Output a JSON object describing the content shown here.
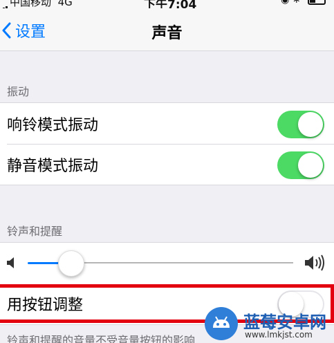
{
  "status_bar": {
    "carrier": "中国移动",
    "network": "4G",
    "time": "下午7:04"
  },
  "nav": {
    "back_label": "设置",
    "title": "声音"
  },
  "vibration_section": {
    "header": "振动",
    "rows": [
      {
        "label": "响铃模式振动",
        "toggle": "on"
      },
      {
        "label": "静音模式振动",
        "toggle": "on"
      }
    ]
  },
  "ringer_section": {
    "header": "铃声和提醒",
    "volume_level": 0.2
  },
  "button_adjust": {
    "label": "用按钮调整",
    "toggle": "off"
  },
  "footer": {
    "text": "铃声和提醒的音量不受音量按钮的影响"
  },
  "watermark": {
    "title": "蓝莓安卓网",
    "url": "www.lmkjst.com"
  },
  "colors": {
    "accent": "#007aff",
    "toggle_on": "#4cd964",
    "highlight": "#e3000f",
    "background": "#efeff4"
  }
}
